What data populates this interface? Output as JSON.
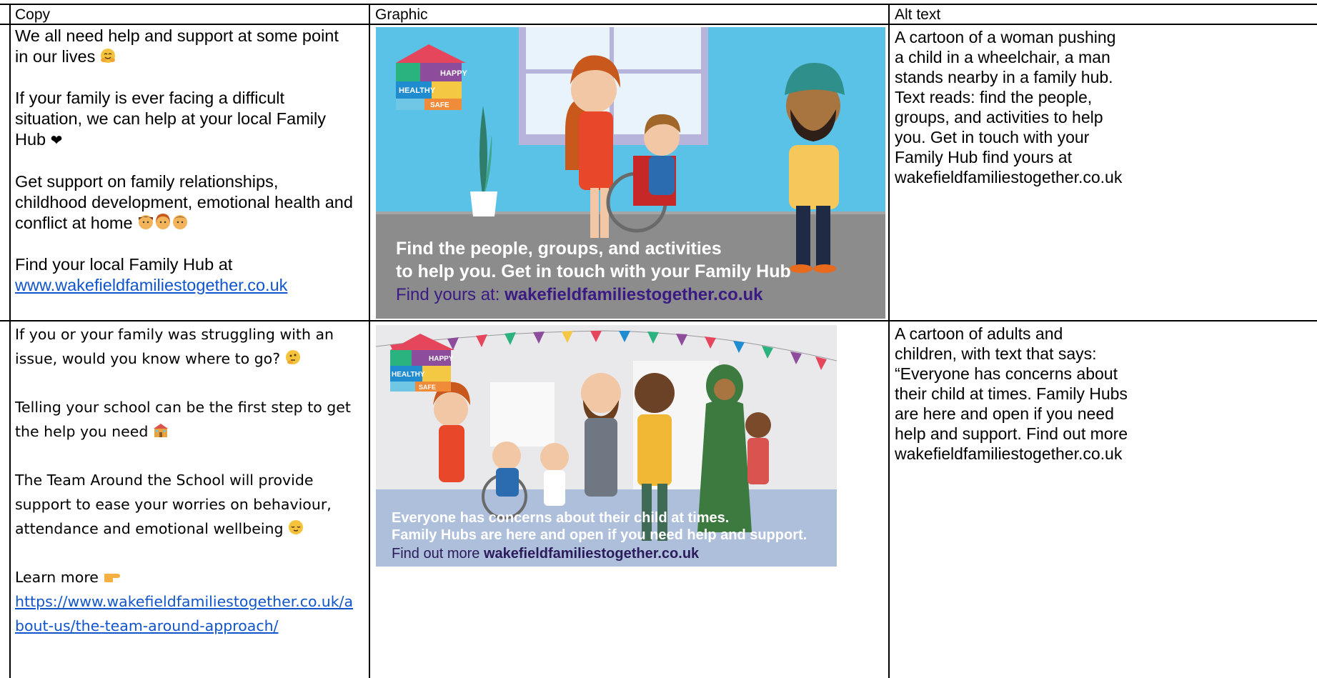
{
  "headers": {
    "copy": "Copy",
    "graphic": "Graphic",
    "alt": "Alt text"
  },
  "rows": [
    {
      "copy": {
        "p1": "We all need help and support at some point in our lives",
        "p1_emoji": "hugging-face-emoji",
        "p2": "If your family is ever facing a difficult situation, we can help at your local Family Hub",
        "p2_emoji": "heart-emoji",
        "p2_emoji_glyph": "❤",
        "p3": "Get support on family relationships, childhood development, emotional health and conflict at home",
        "p3_emoji": "family-faces-emoji",
        "p4": "Find your local Family Hub at",
        "link": "www.wakefieldfamiliestogether.co.uk"
      },
      "graphic": {
        "logo": {
          "w1": "HAPPY",
          "w2": "HEALTHY",
          "w3": "SAFE"
        },
        "line1": "Find the people, groups, and activities",
        "line2": "to help you. Get in touch with your Family Hub",
        "line3_prefix": "Find yours at: ",
        "line3_url": "wakefieldfamiliestogether.co.uk",
        "colors": {
          "background": "#5bc2e7",
          "floor": "#8c8c8c"
        }
      },
      "alt_lines": [
        "A cartoon of a woman pushing",
        "a child in a wheelchair, a man",
        "stands nearby in a family hub.",
        "Text reads: find the people,",
        "groups, and activities to help",
        "you. Get in touch with your",
        "Family Hub find yours at",
        "wakefieldfamiliestogether.co.uk"
      ]
    },
    {
      "copy": {
        "p1": "If you or your family was struggling with an issue, would you know where to go?",
        "p1_emoji": "thinking-face-emoji",
        "p2": "Telling your school can be the first step to get the help you need",
        "p2_emoji": "school-emoji",
        "p3": "The Team Around the School will provide support to ease your worries on behaviour, attendance and emotional wellbeing",
        "p3_emoji": "relieved-face-emoji",
        "p4": "Learn more",
        "p4_emoji": "pointing-right-emoji",
        "link": "https://www.wakefieldfamiliestogether.co.uk/about-us/the-team-around-approach/"
      },
      "graphic": {
        "logo": {
          "w1": "HAPPY",
          "w2": "HEALTHY",
          "w3": "SAFE"
        },
        "line1": "Everyone has concerns about their child at times.",
        "line2": "Family Hubs are here and open if you need help and support.",
        "line3_prefix": "Find out more ",
        "line3_url": "wakefieldfamiliestogether.co.uk",
        "colors": {
          "background": "#e9e9ec",
          "floor": "#aebfdc"
        }
      },
      "alt_lines": [
        "A cartoon of adults and",
        "children, with text that says:",
        "“Everyone has concerns about",
        "their child at times. Family Hubs",
        "are here and open if you need",
        "help and support. Find out more",
        "wakefieldfamiliestogether.co.uk"
      ]
    }
  ]
}
